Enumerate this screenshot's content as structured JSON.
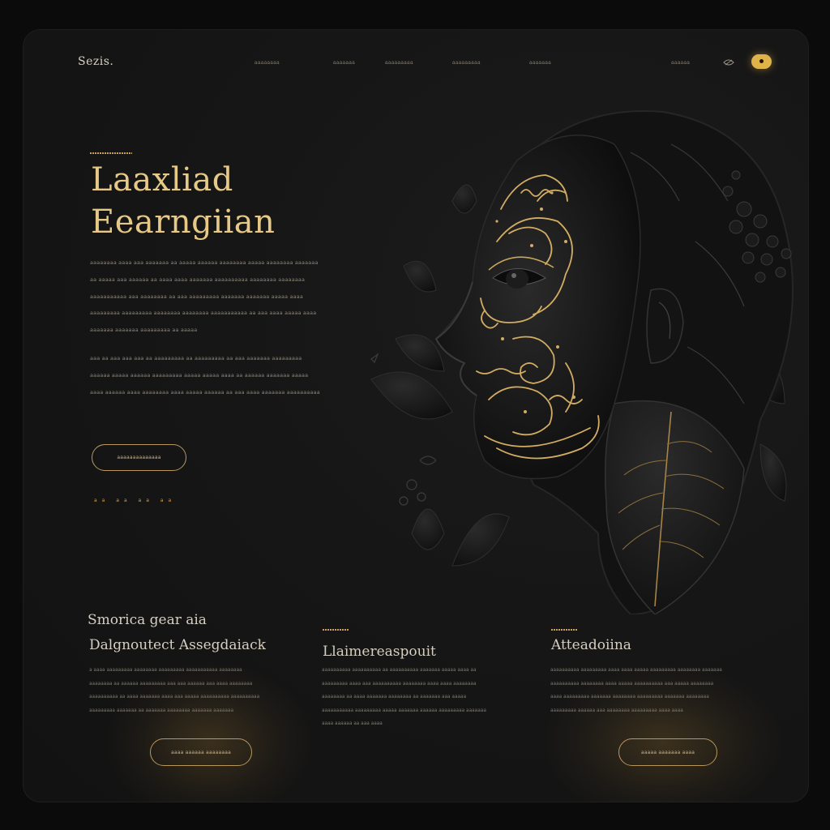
{
  "header": {
    "logo": "Sezis.",
    "nav": [
      "aaaaaaaa",
      "aaaaaaa",
      "aaaaaaaaa",
      "aaaaaaaaa",
      "aaaaaaa",
      "aaaaaa"
    ]
  },
  "hero": {
    "title_line1": "Laaxliad",
    "title_line2": "Eearngiian",
    "paragraph1": "aaaaaaaa aaaa aaa aaaaaaa aa aaaaa aaaaaa aaaaaaaa aaaaa aaaaaaaa aaaaaaa aa aaaaa aaa aaaaaa aa aaaa aaaa aaaaaaa aaaaaaaaaa aaaaaaaa aaaaaaaa aaaaaaaaaaa aaa aaaaaaaa aa aaa aaaaaaaaa aaaaaaa aaaaaaa aaaaa aaaa aaaaaaaaa aaaaaaaaa aaaaaaaa aaaaaaaa aaaaaaaaaaa aa aaa aaaa aaaaa aaaa aaaaaaa aaaaaaa aaaaaaaaa aa aaaaa",
    "paragraph2": "aaa aa aaa aaa aaa aa aaaaaaaaa aa aaaaaaaaa aa aaa aaaaaaa aaaaaaaaa aaaaaa aaaaa aaaaaa aaaaaaaaa aaaaa aaaaa aaaa aa aaaaaa aaaaaaa aaaaa aaaa aaaaaa aaaa aaaaaaaa aaaa aaaaa aaaaaa aa aaa aaaa aaaaaaa aaaaaaaaaa",
    "button": "aaaaaaaaaaaaaa",
    "dots": "aa aa aa aa"
  },
  "columns": [
    {
      "kicker": "Smorica gear aia",
      "title": "Dalgnoutect Assegdaiack",
      "text": "a aaaa aaaaaaaaa aaaaaaaa aaaaaaaaa aaaaaaaaaaa aaaaaaaa aaaaaaaa aa aaaaaa aaaaaaaaa aaa aaa aaaaaa aaa aaaa aaaaaaaa aaaaaaaaaa aa aaaa aaaaaaa aaaa aaa aaaaa aaaaaaaaaa aaaaaaaaaa aaaaaaaaa aaaaaaa aa aaaaaaa aaaaaaaa aaaaaaa aaaaaaa",
      "button": "aaaa aaaaaa aaaaaaaa"
    },
    {
      "title": "Llaimereaspouit",
      "text": "aaaaaaaaaa aaaaaaaaaa aa aaaaaaaaaa aaaaaaa aaaaa aaaa aa aaaaaaaaa aaaa aaa aaaaaaaaaa aaaaaaaa aaaa aaaa aaaaaaaa aaaaaaaa aa aaaa aaaaaaa aaaaaaaa aa aaaaaaa aaa aaaaa aaaaaaaaaaa aaaaaaaaa aaaaa aaaaaaa aaaaaa aaaaaaaaa aaaaaaa aaaa aaaaaa aa aaa aaaa"
    },
    {
      "title": "Atteadoiina",
      "text": "aaaaaaaaaa aaaaaaaaa aaaa aaaa aaaaa aaaaaaaaa aaaaaaaa aaaaaaa aaaaaaaaaa aaaaaaaa aaaa aaaaa aaaaaaaaaa aaa aaaaa aaaaaaaa aaaa aaaaaaaaa aaaaaaa aaaaaaaa aaaaaaaaa aaaaaaa aaaaaaaa aaaaaaaaa aaaaaa aaa aaaaaaaa aaaaaaaaa aaaa aaaa",
      "button": "aaaaa aaaaaaa aaaa"
    }
  ],
  "colors": {
    "gold": "#e0b24a",
    "background": "#121212",
    "text": "#8c867a"
  }
}
